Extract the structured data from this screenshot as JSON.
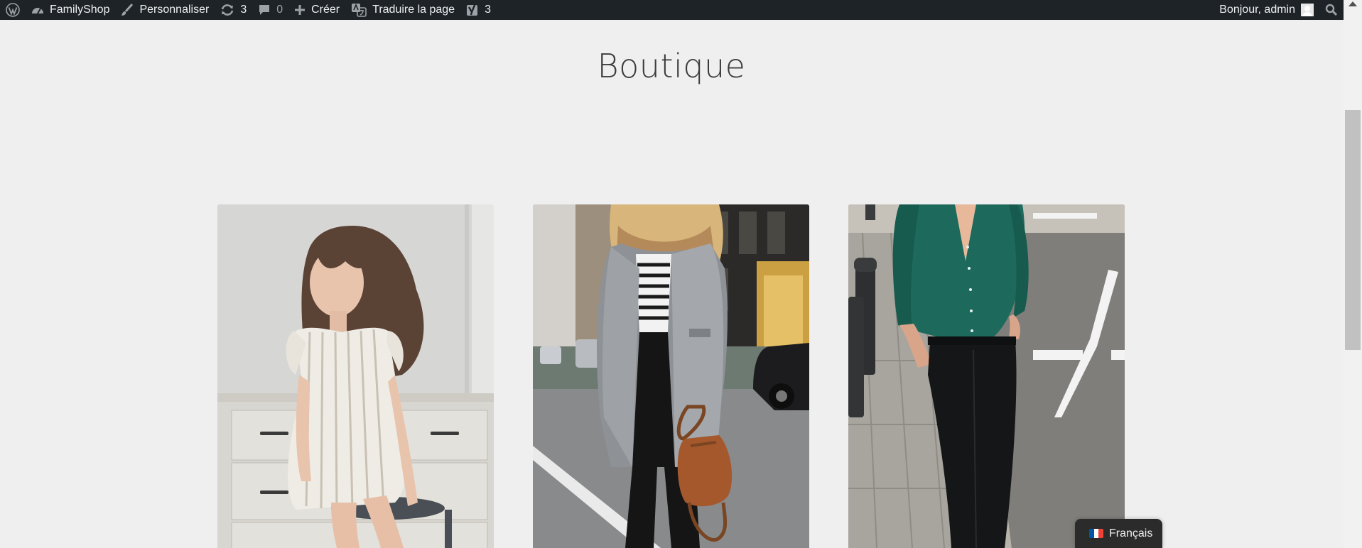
{
  "adminbar": {
    "site_name": "FamilyShop",
    "customize": "Personnaliser",
    "updates_count": "3",
    "comments_count": "0",
    "new_label": "Créer",
    "translate": "Traduire la page",
    "seo_count": "3",
    "greeting": "Bonjour, admin"
  },
  "page": {
    "title": "Boutique"
  },
  "products": [
    {
      "image": "girl-striped-dress-photo"
    },
    {
      "image": "woman-grey-coat-photo"
    },
    {
      "image": "man-green-shirt-photo"
    }
  ],
  "language": {
    "label": "Français",
    "flag_colors": [
      "#0055a4",
      "#ffffff",
      "#ef4135"
    ]
  },
  "colors": {
    "adminbar_bg": "#1d2327",
    "page_bg": "#efefef",
    "title": "#3b3b3b"
  }
}
